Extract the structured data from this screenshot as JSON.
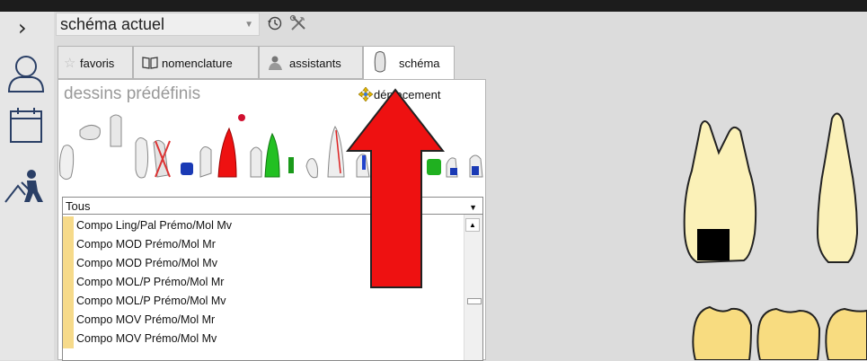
{
  "colors": {
    "accent_arrow": "#ee1111",
    "swatch": "#f6da8a",
    "tooth_fill": "#fbf1b8"
  },
  "header": {
    "expand_icon": "chevron-right-icon",
    "schema_selector": {
      "value": "schéma actuel"
    },
    "history_icon": "history-icon",
    "tools_icon": "tools-icon"
  },
  "sidebar": {
    "icons": [
      "user-icon",
      "calendar-icon",
      "worker-icon"
    ]
  },
  "tabs": [
    {
      "label": "favoris",
      "icon": "star-icon"
    },
    {
      "label": "nomenclature",
      "icon": "book-icon"
    },
    {
      "label": "assistants",
      "icon": "assistant-icon"
    },
    {
      "label": "schéma",
      "icon": "tooth-icon",
      "active": true
    }
  ],
  "panel": {
    "title": "dessins prédéfinis",
    "move_label": "déplacement",
    "filter_value": "Tous",
    "items": [
      "Compo Ling/Pal Prémo/Mol Mv",
      "Compo MOD Prémo/Mol Mr",
      "Compo MOD Prémo/Mol Mv",
      "Compo MOL/P Prémo/Mol Mr",
      "Compo MOL/P Prémo/Mol Mv",
      "Compo MOV Prémo/Mol Mr",
      "Compo MOV Prémo/Mol Mv"
    ]
  }
}
